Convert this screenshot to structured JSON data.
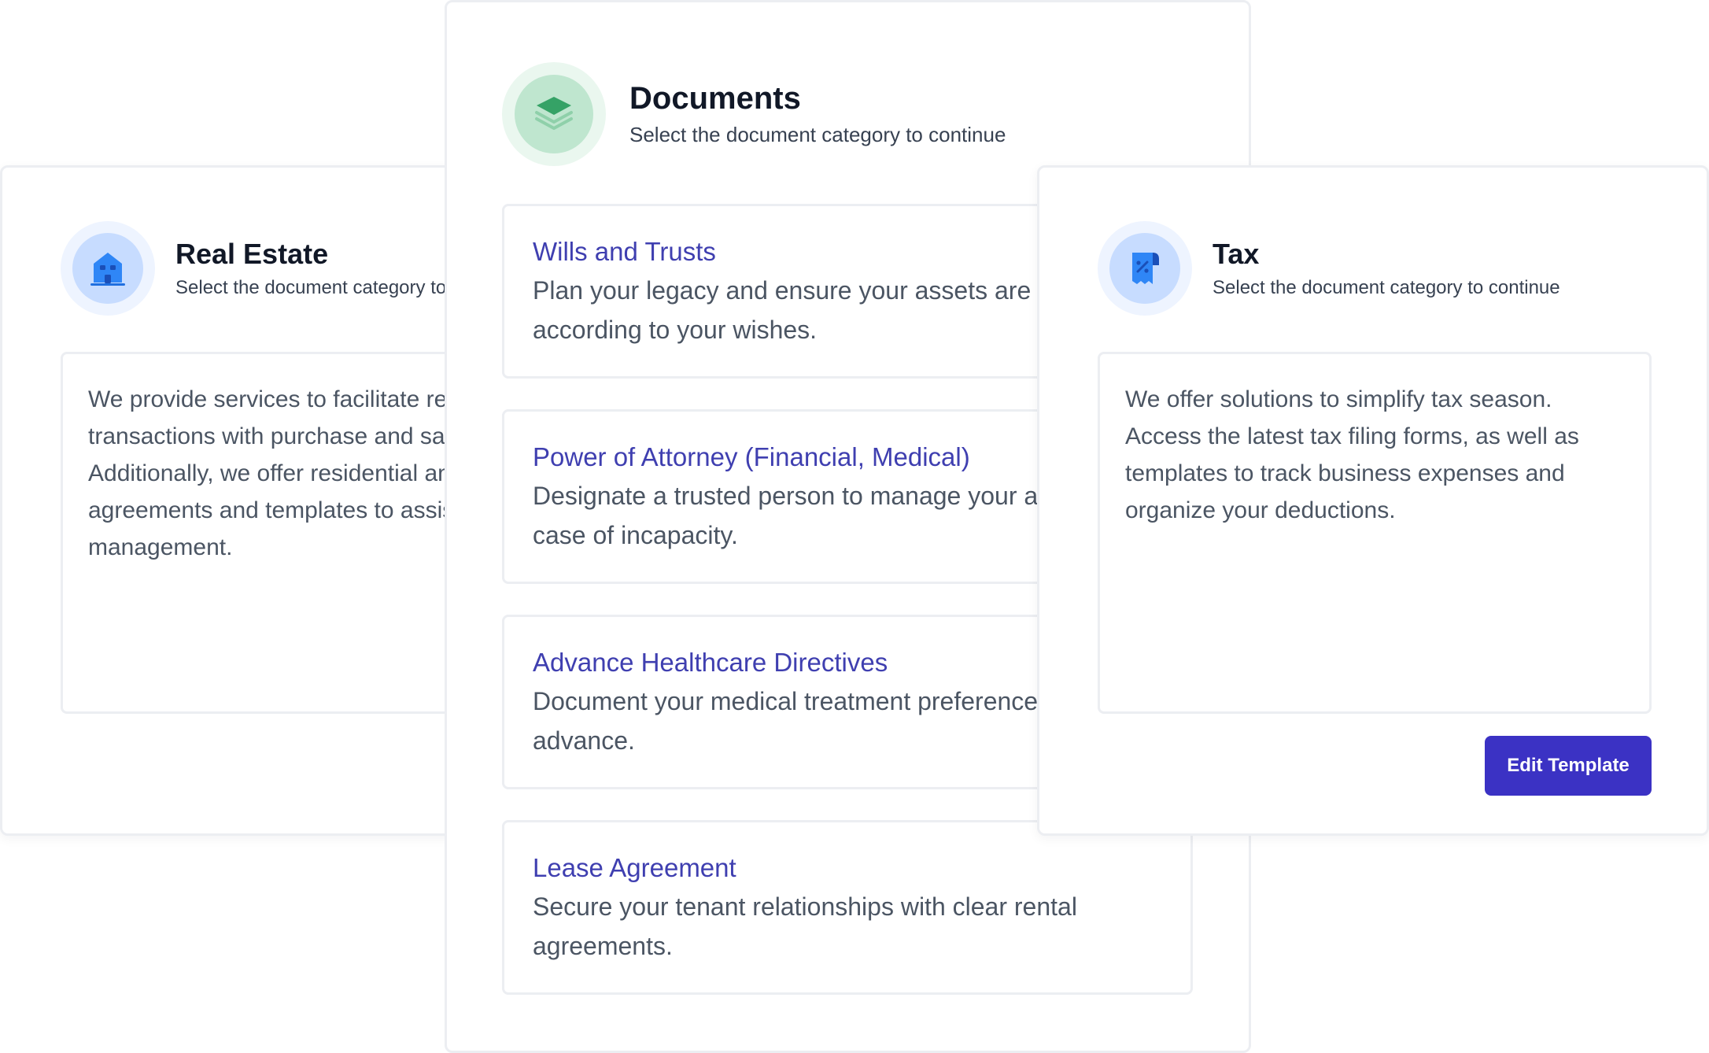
{
  "cards": {
    "real_estate": {
      "icon": "building-icon",
      "title": "Real Estate",
      "subtitle": "Select the document category to continue",
      "description": "We provide services to facilitate real estate transactions with purchase and sale agreements. Additionally, we offer residential and commercial lease agreements and templates to assist with property management."
    },
    "documents": {
      "icon": "layers-icon",
      "title": "Documents",
      "subtitle": "Select the document category to continue",
      "items": [
        {
          "title": "Wills and Trusts",
          "description": "Plan your legacy and ensure your assets are distributed according to your wishes."
        },
        {
          "title": "Power of Attorney (Financial, Medical)",
          "description": "Designate a trusted person to manage your affairs in case of incapacity."
        },
        {
          "title": "Advance Healthcare Directives",
          "description": "Document your medical treatment preferences in advance."
        },
        {
          "title": "Lease Agreement",
          "description": "Secure your tenant relationships with clear rental agreements."
        }
      ]
    },
    "tax": {
      "icon": "tax-receipt-icon",
      "title": "Tax",
      "subtitle": "Select the document category to continue",
      "description": "We offer solutions to simplify tax season. Access the latest tax filing forms, as well as templates to track business expenses and organize your deductions.",
      "button_label": "Edit Template"
    }
  },
  "colors": {
    "accent": "#3b32c4",
    "link": "#3f3fb0",
    "green_icon": "#35a266",
    "blue_icon": "#1f7cf0"
  }
}
